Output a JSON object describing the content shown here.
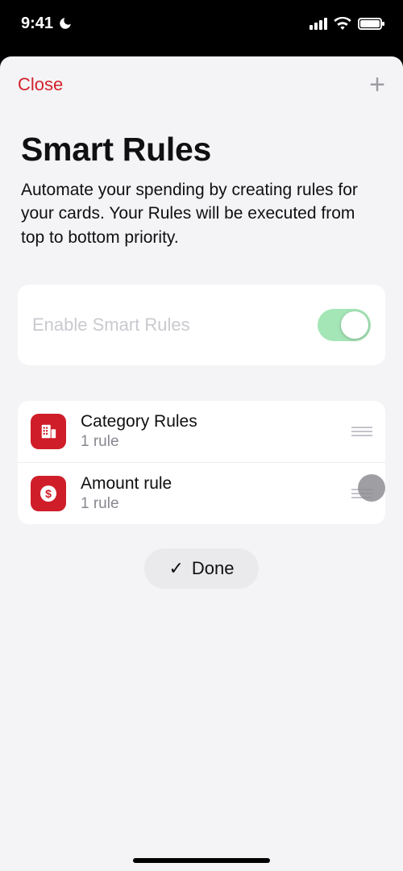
{
  "status": {
    "time": "9:41"
  },
  "sheet": {
    "close_label": "Close",
    "title": "Smart Rules",
    "description": "Automate your spending by creating rules for your cards. Your Rules will be executed from top to bottom priority.",
    "enable_label": "Enable Smart Rules",
    "enabled": true,
    "rules": [
      {
        "title": "Category Rules",
        "subtitle": "1 rule",
        "icon": "building"
      },
      {
        "title": "Amount rule",
        "subtitle": "1 rule",
        "icon": "dollar"
      }
    ],
    "done_label": "Done"
  }
}
